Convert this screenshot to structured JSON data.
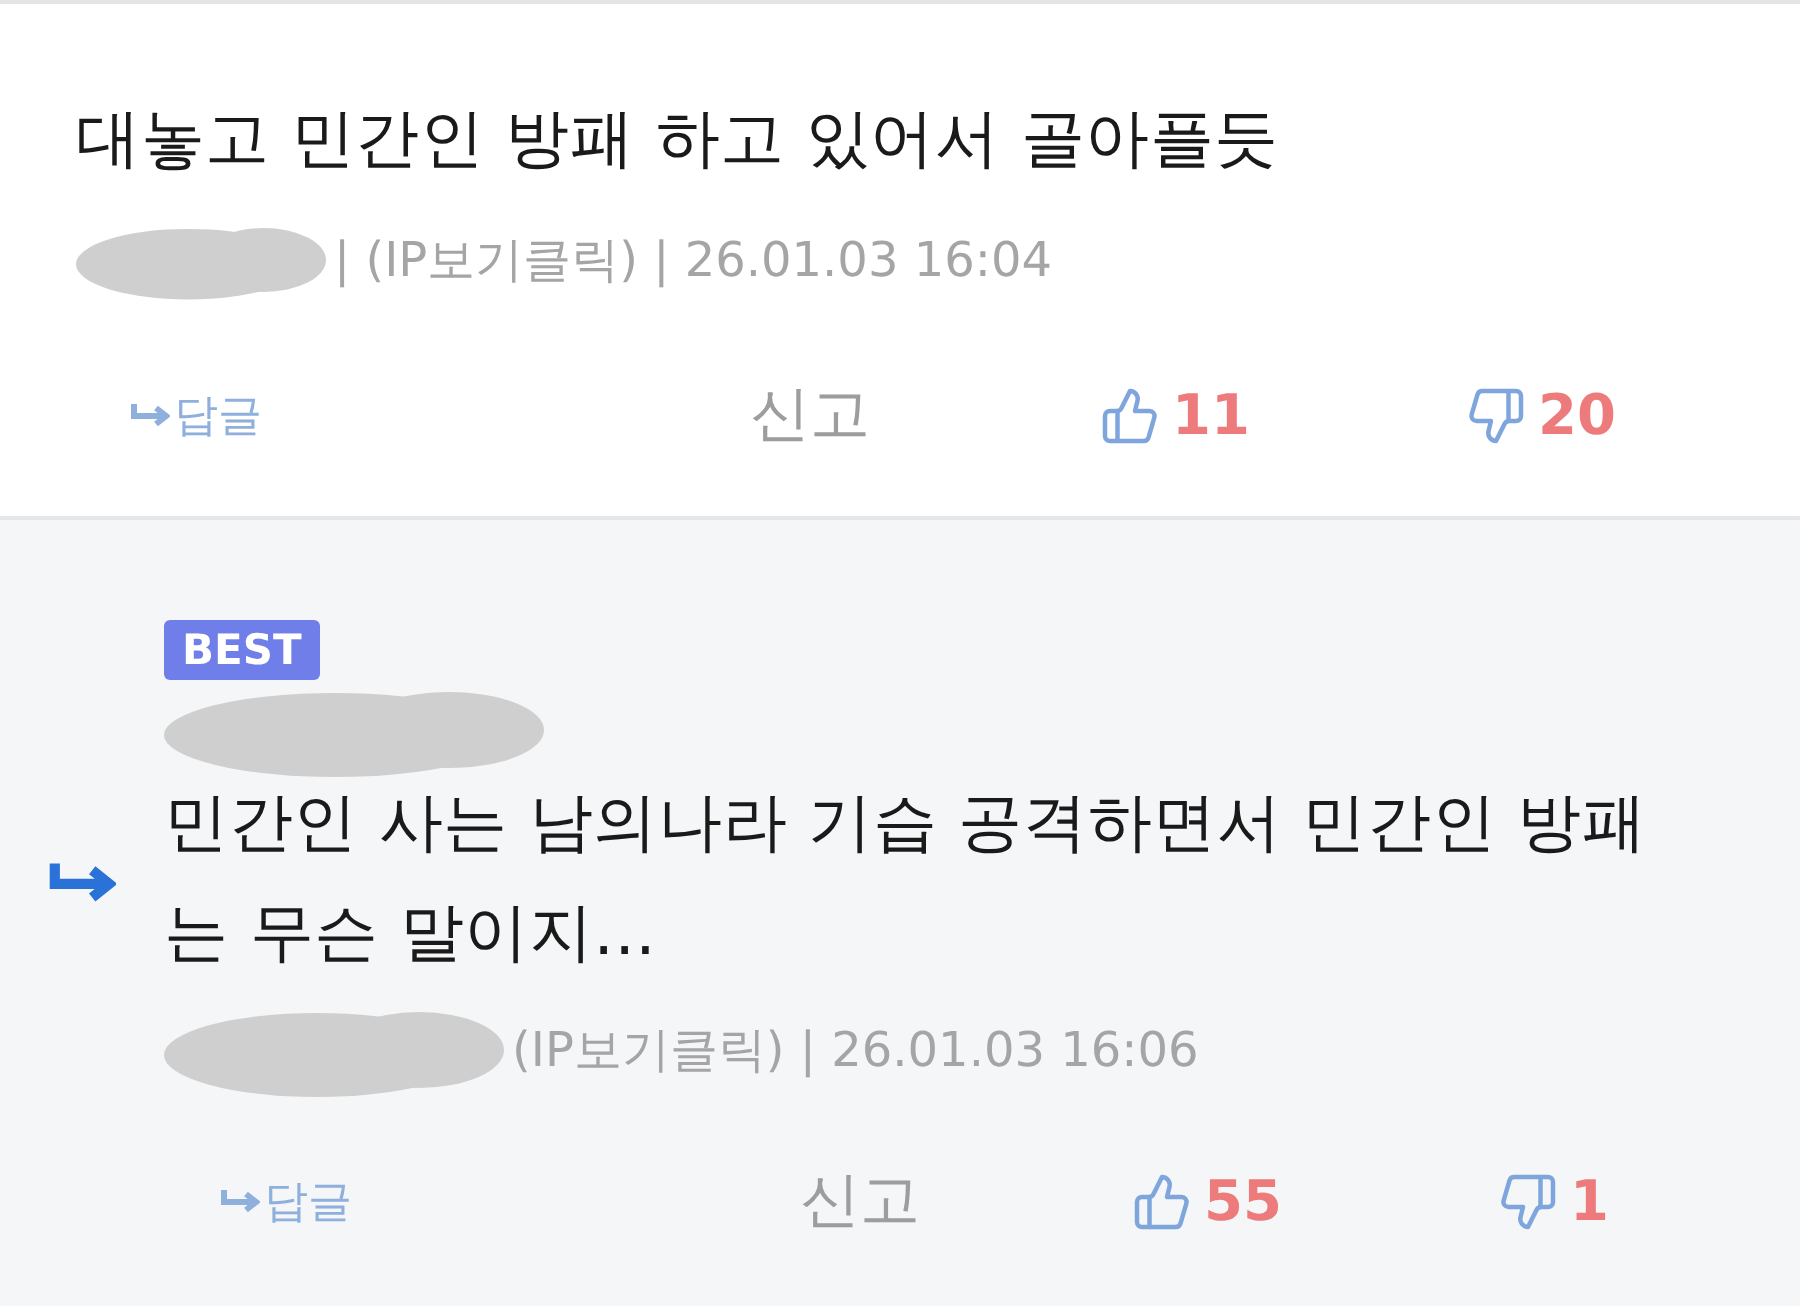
{
  "comments": [
    {
      "kind": "plain",
      "text": "대놓고 민간인 방패 하고 있어서 골아플듯",
      "meta": "| (IP보기클릭) | 26.01.03 16:04",
      "reply_label": "답글",
      "report_label": "신고",
      "likes": "11",
      "dislikes": "20"
    },
    {
      "kind": "reply",
      "best": "BEST",
      "text": "민간인 사는 남의나라 기습 공격하면서 민간인 방패는 무슨 말이지...",
      "meta": "(IP보기클릭) | 26.01.03 16:06",
      "reply_label": "답글",
      "report_label": "신고",
      "likes": "55",
      "dislikes": "1"
    }
  ]
}
